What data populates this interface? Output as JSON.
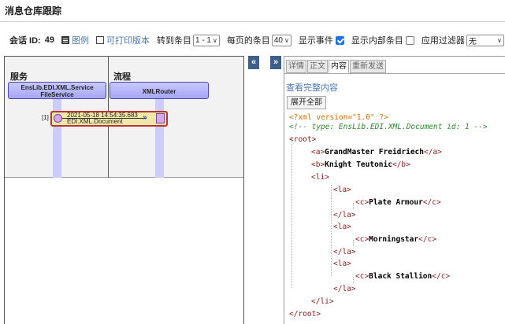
{
  "page": {
    "title": "消息仓库跟踪"
  },
  "toolbar": {
    "session_label": "会话 ID:",
    "session_id": "49",
    "legend_label": "图例",
    "print_label": "可打印版本",
    "goto_label": "转到条目",
    "goto_value": "1 - 1",
    "per_page_label": "每页的条目",
    "per_page_value": "40",
    "show_events_label": "显示事件",
    "show_events_checked": true,
    "show_internal_label": "显示内部条目",
    "show_internal_checked": false,
    "filter_label": "应用过滤器",
    "filter_value": "无"
  },
  "diagram": {
    "col_services": "服务",
    "col_processes": "流程",
    "host_service": "EnsLib.EDI.XML.Service FileService",
    "host_service_line1": "EnsLib.EDI.XML.Service",
    "host_service_line2": "FileService",
    "host_process": "XMLRouter",
    "message": {
      "index": "[1]",
      "time": "2021-05-18 14:54:35.683",
      "type": "EDI.XML.Document"
    },
    "colors": {
      "host_fill": "#b4b4f8",
      "lifeline": "#ccccff",
      "message_fill": "#f0e8a8",
      "message_border": "#b33333"
    }
  },
  "buttons": {
    "collapse_left": "«",
    "expand_right": "»"
  },
  "detail": {
    "tabs": [
      "详情",
      "正文",
      "内容",
      "重新发送"
    ],
    "active_tab": "内容",
    "view_full": "查看完整内容",
    "expand_all": "展开全部",
    "xml": {
      "decl": "<?xml version=\"1.0\" ?>",
      "comment": "<!-- type: EnsLib.EDI.XML.Document  id: 1 -->",
      "root_open": "<root>",
      "a_open": "<a>",
      "a_text": "GrandMaster Freidriech",
      "a_close": "</a>",
      "b_open": "<b>",
      "b_text": "Knight Teutonic",
      "b_close": "</b>",
      "li_open": "<li>",
      "la_open": "<la>",
      "la_close": "</la>",
      "c_open": "<c>",
      "c_close": "</c>",
      "c1_text": "Plate Armour",
      "c2_text": "Morningstar",
      "c3_text": "Black Stallion",
      "li_close": "</li>",
      "root_close": "</root>"
    }
  }
}
